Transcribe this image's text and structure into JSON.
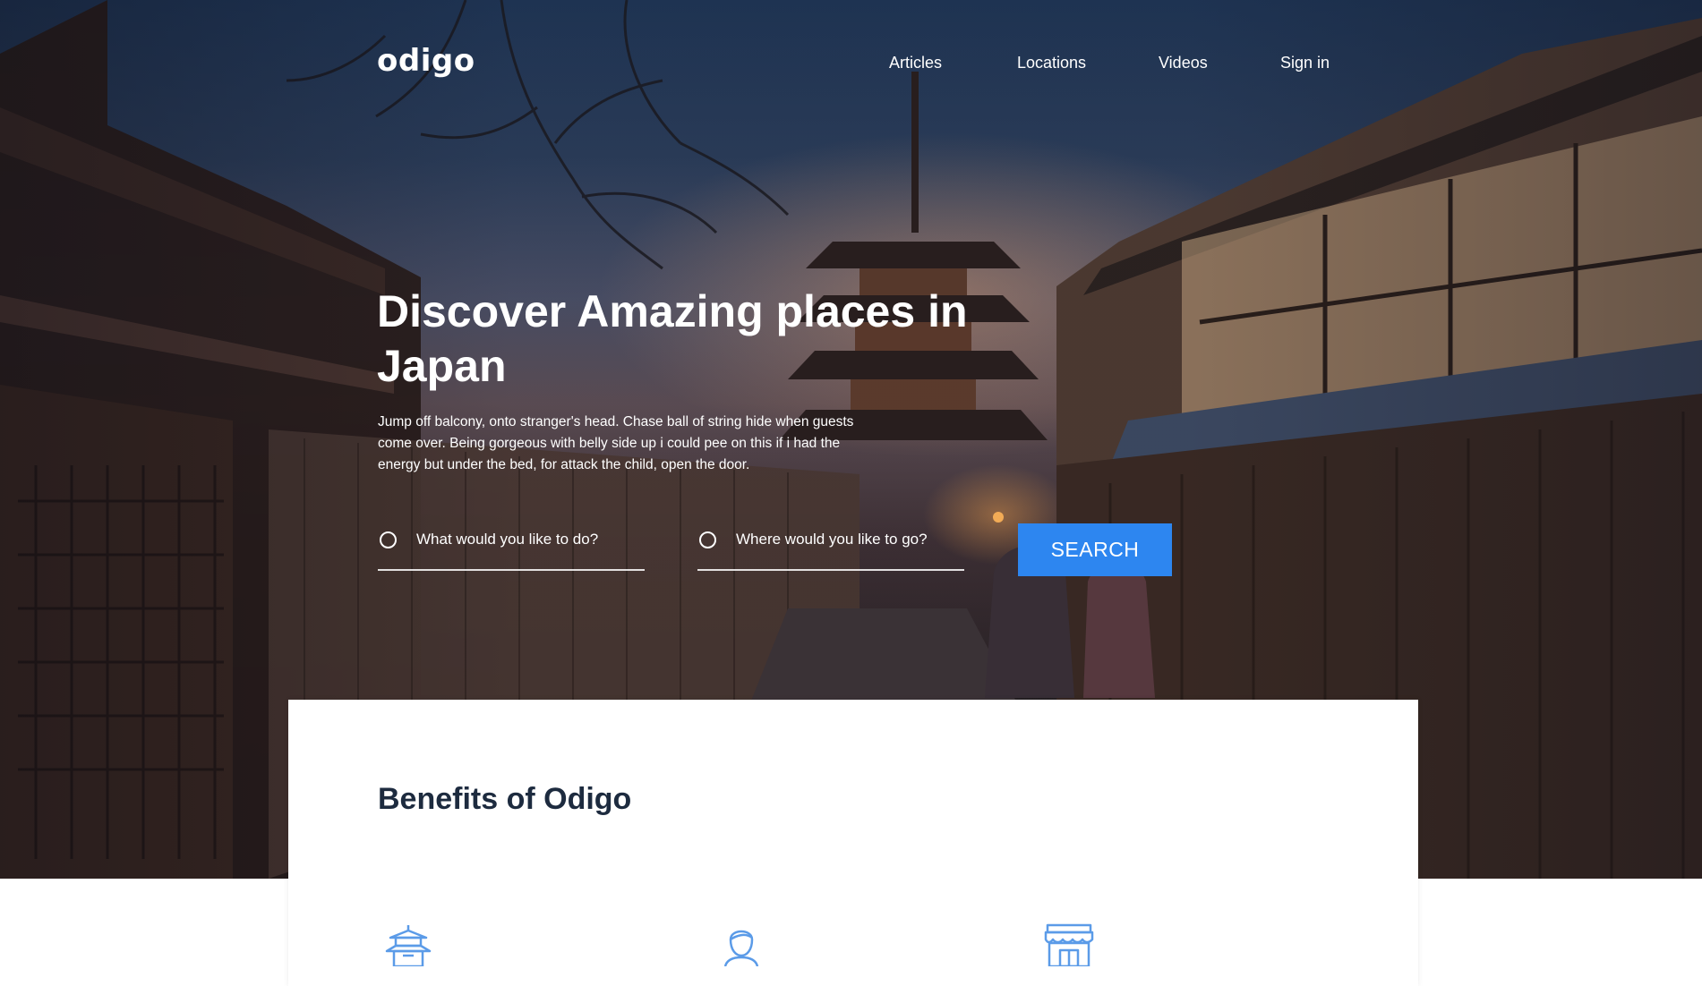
{
  "header": {
    "logo": "odigo",
    "nav": [
      {
        "label": "Articles"
      },
      {
        "label": "Locations"
      },
      {
        "label": "Videos"
      },
      {
        "label": "Sign in"
      }
    ]
  },
  "hero": {
    "title": "Discover Amazing places in Japan",
    "description": "Jump off balcony, onto stranger's head. Chase ball of string hide when guests come over. Being gorgeous with belly side up i could pee on this if i had the energy but under the bed, for attack the child, open the door.",
    "search": {
      "activity_placeholder": "What would you like to do?",
      "destination_placeholder": "Where would you like to go?",
      "button_label": "SEARCH"
    }
  },
  "benefits": {
    "title": "Benefits of Odigo",
    "icons": [
      "pagoda-icon",
      "person-icon",
      "shop-icon"
    ]
  },
  "colors": {
    "accent": "#2d86f0",
    "heading_dark": "#1d2b3f",
    "icon_blue": "#5b9be8"
  }
}
